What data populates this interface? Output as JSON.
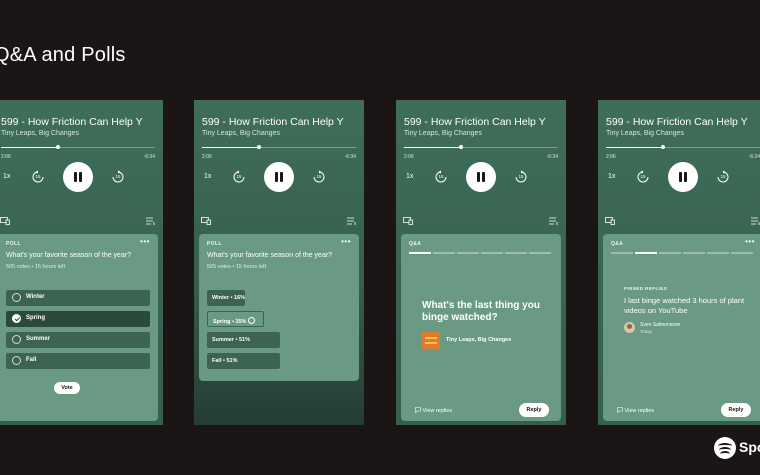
{
  "slide": {
    "title": "Q&A and Polls"
  },
  "player": {
    "episode_title": "599 - How Friction Can Help Y",
    "show": "Tiny Leaps, Big Changes",
    "time_elapsed": "2:06",
    "time_remaining": "-6:34",
    "progress": 0.37,
    "speed": "1x",
    "skip_back": "15",
    "skip_forward": "15"
  },
  "poll": {
    "kind": "POLL",
    "more": "•••",
    "question": "What's your favorite season of the year?",
    "meta": "505 votes • 15 hours left",
    "options": [
      {
        "label": "Winter",
        "selected": false
      },
      {
        "label": "Spring",
        "selected": true
      },
      {
        "label": "Summer",
        "selected": false
      },
      {
        "label": "Fall",
        "selected": false
      }
    ],
    "vote_label": "Vote",
    "results": [
      {
        "label": "Winter • 16%",
        "percent": 16
      },
      {
        "label": "Spring • 35%",
        "percent": 35
      },
      {
        "label": "Summer • 51%",
        "percent": 51
      },
      {
        "label": "Fall • 51%",
        "percent": 51
      }
    ]
  },
  "qa": {
    "kind": "Q&A",
    "more": "•••",
    "question": "What's the last thing you binge watched?",
    "show_label": "Tiny Leaps, Big Changes",
    "view_replies": "View replies",
    "reply_label": "Reply",
    "pinned_header": "PINNED REPLIES",
    "pinned_reply": "I last binge watched 3 hours of plant videos on YouTube",
    "pinned_author": "Sven Salmonsson",
    "pinned_time": "Today"
  },
  "brand": {
    "name": "Spotify"
  },
  "colors": {
    "background": "#1b1515",
    "player_green": "#3f6e58",
    "card_green": "#6a9a84",
    "option_green": "#3d6353"
  }
}
